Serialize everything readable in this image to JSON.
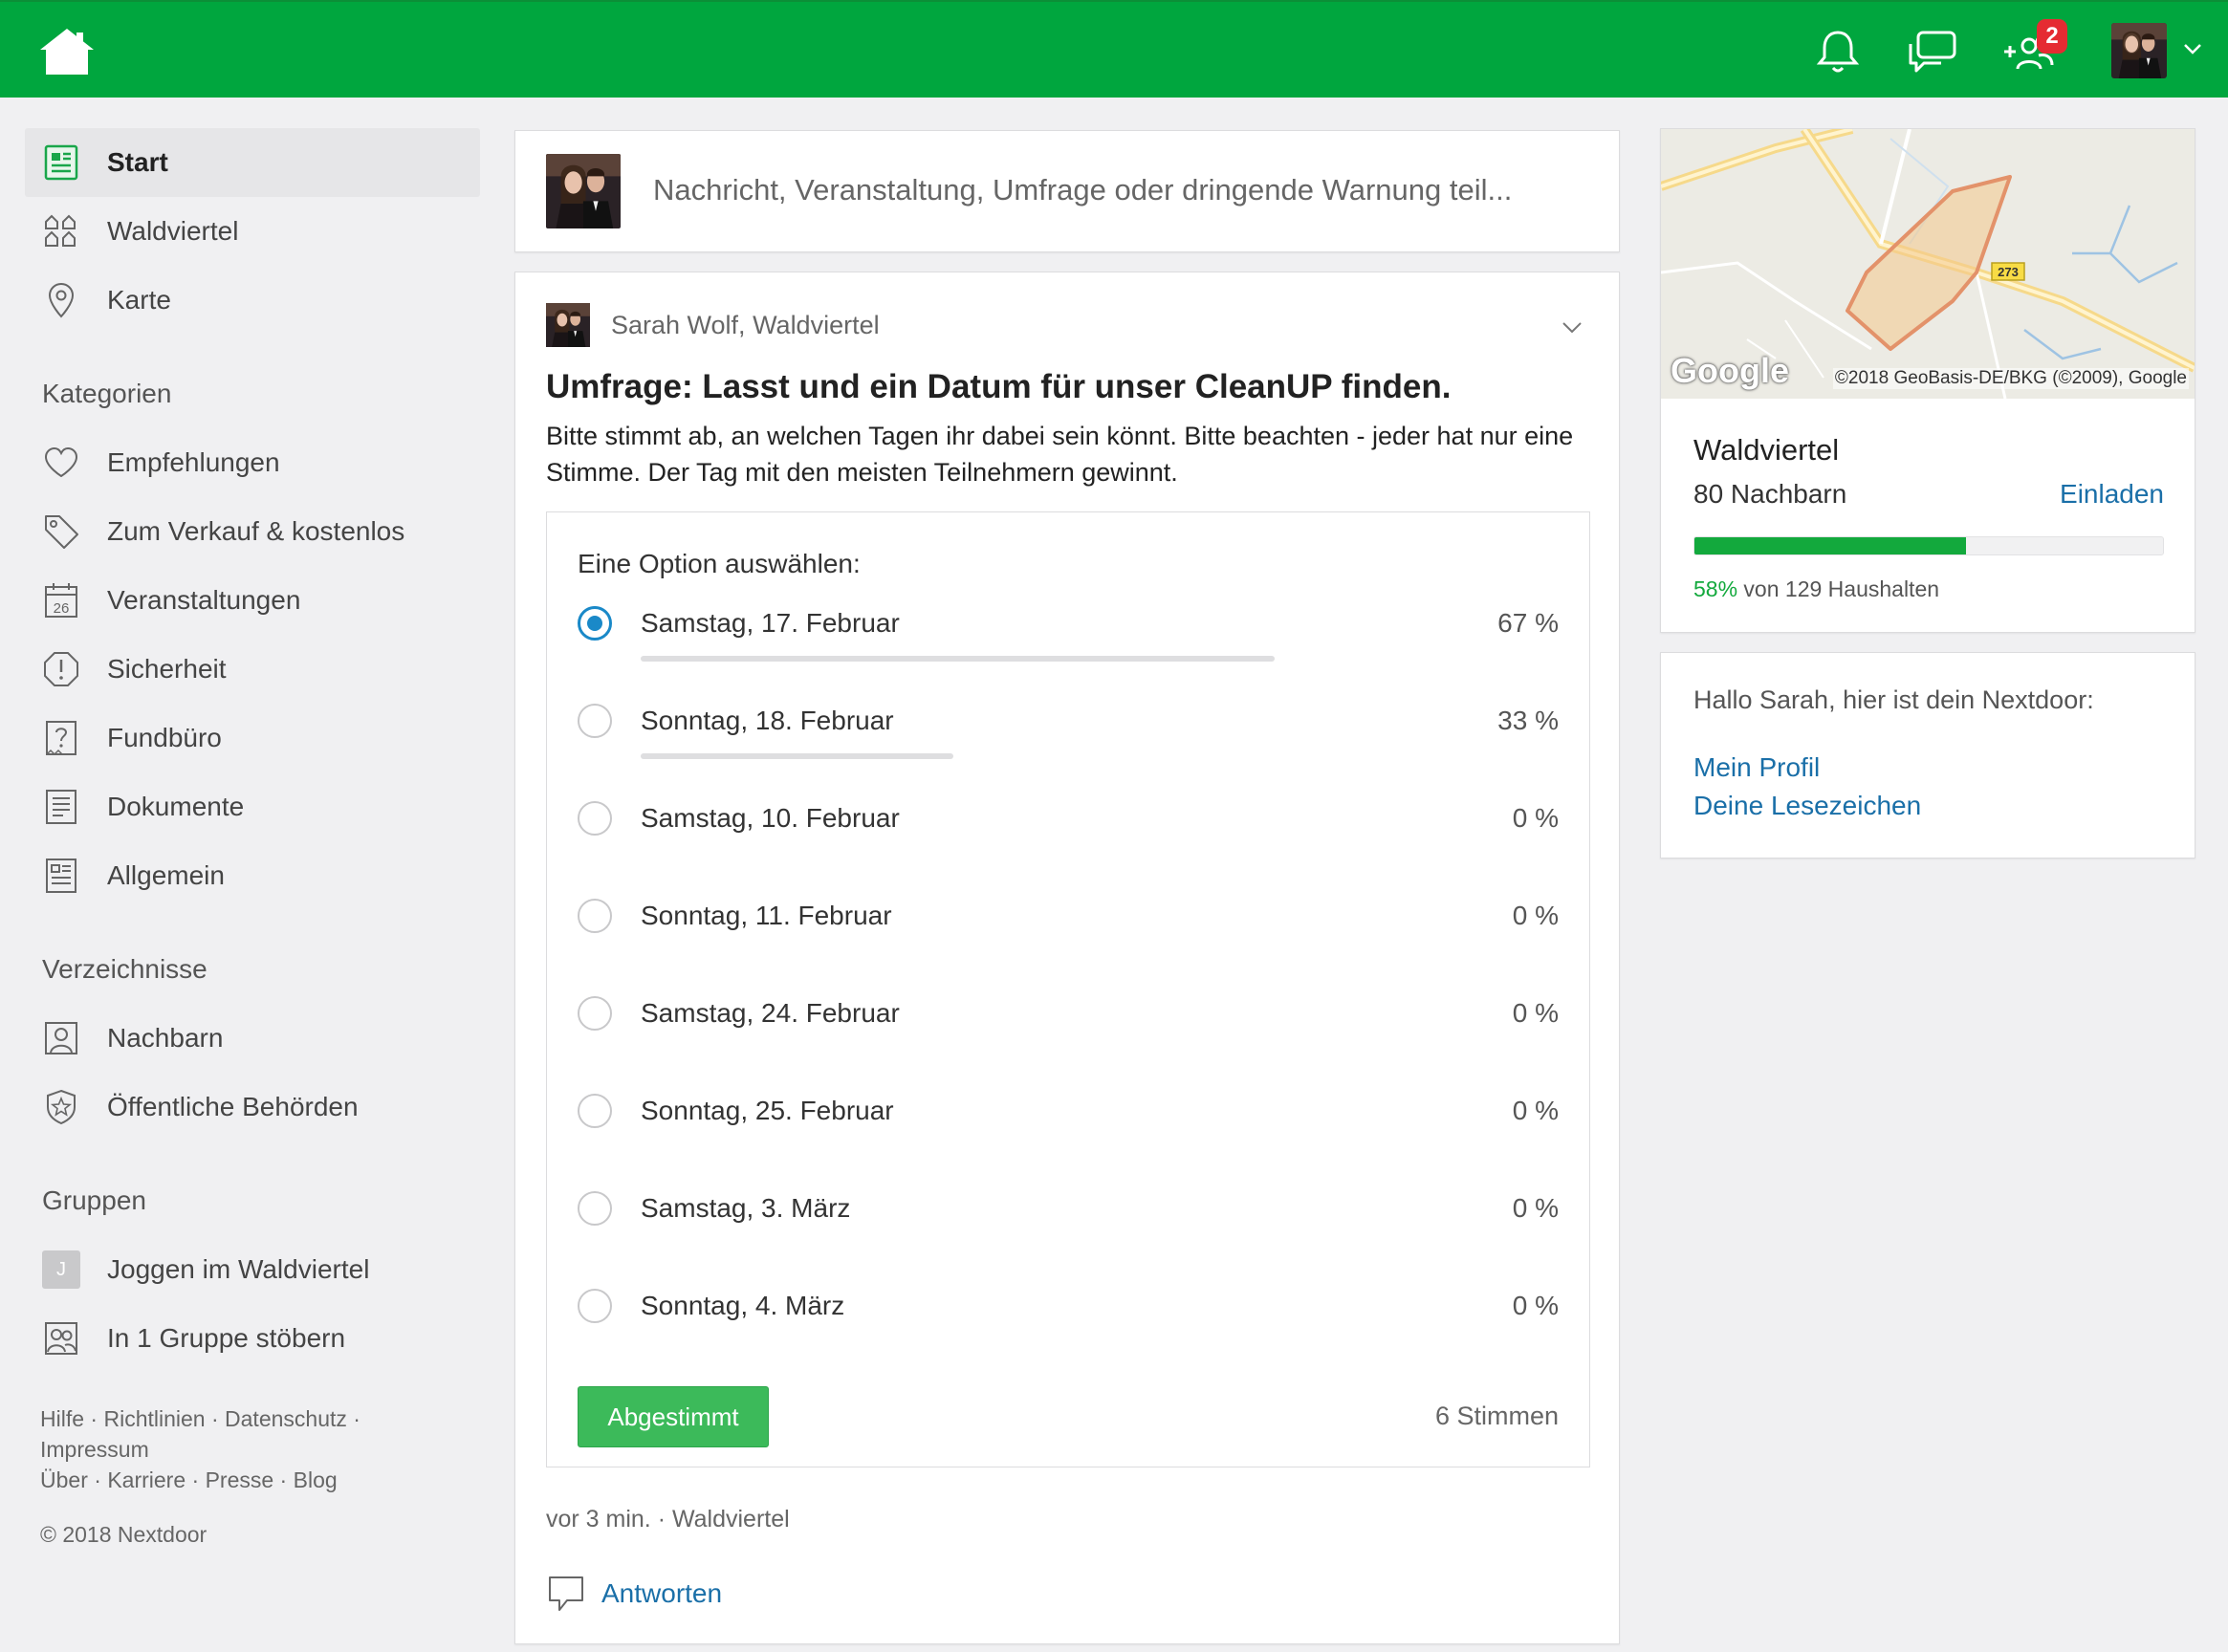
{
  "topbar": {
    "icons": [
      "home-icon",
      "bell-icon",
      "chat-icon",
      "add-neighbors-icon",
      "chevron-down-icon"
    ],
    "notification_count": "2",
    "brand_color": "#00a63e"
  },
  "sidebar": {
    "nav": [
      {
        "label": "Start",
        "icon": "newsfeed-icon"
      },
      {
        "label": "Waldviertel",
        "icon": "neighborhood-icon"
      },
      {
        "label": "Karte",
        "icon": "map-pin-icon"
      }
    ],
    "categories_title": "Kategorien",
    "categories": [
      {
        "label": "Empfehlungen",
        "icon": "heart-icon"
      },
      {
        "label": "Zum Verkauf & kostenlos",
        "icon": "tag-icon"
      },
      {
        "label": "Veranstaltungen",
        "icon": "calendar-icon",
        "calendar_day": "26"
      },
      {
        "label": "Sicherheit",
        "icon": "warning-icon"
      },
      {
        "label": "Fundbüro",
        "icon": "lost-found-icon"
      },
      {
        "label": "Dokumente",
        "icon": "document-icon"
      },
      {
        "label": "Allgemein",
        "icon": "general-icon"
      }
    ],
    "directories_title": "Verzeichnisse",
    "directories": [
      {
        "label": "Nachbarn",
        "icon": "neighbor-icon"
      },
      {
        "label": "Öffentliche Behörden",
        "icon": "badge-icon"
      }
    ],
    "groups_title": "Gruppen",
    "groups": [
      {
        "label": "Joggen im Waldviertel",
        "badge": "J"
      },
      {
        "label": "In 1 Gruppe stöbern",
        "icon": "browse-groups-icon"
      }
    ],
    "footer": {
      "line1": [
        "Hilfe",
        "Richtlinien",
        "Datenschutz"
      ],
      "line2": [
        "Impressum"
      ],
      "line3": [
        "Über",
        "Karriere",
        "Presse",
        "Blog"
      ],
      "copyright": "© 2018 Nextdoor"
    }
  },
  "composer": {
    "placeholder": "Nachricht, Veranstaltung, Umfrage oder dringende Warnung teil..."
  },
  "post": {
    "author": "Sarah Wolf, Waldviertel",
    "title": "Umfrage: Lasst und ein Datum für unser CleanUP finden.",
    "body": "Bitte stimmt ab, an welchen Tagen ihr dabei sein könnt. Bitte beachten - jeder hat nur eine Stimme. Der Tag mit den meisten Teilnehmern gewinnt.",
    "poll": {
      "prompt": "Eine Option auswählen:",
      "options": [
        {
          "label": "Samstag, 17. Februar",
          "pct_label": "67 %",
          "share": 0.67,
          "selected": true
        },
        {
          "label": "Sonntag, 18. Februar",
          "pct_label": "33 %",
          "share": 0.33,
          "selected": false
        },
        {
          "label": "Samstag, 10. Februar",
          "pct_label": "0 %",
          "share": 0,
          "selected": false
        },
        {
          "label": "Sonntag, 11. Februar",
          "pct_label": "0 %",
          "share": 0,
          "selected": false
        },
        {
          "label": "Samstag, 24. Februar",
          "pct_label": "0 %",
          "share": 0,
          "selected": false
        },
        {
          "label": "Sonntag, 25. Februar",
          "pct_label": "0 %",
          "share": 0,
          "selected": false
        },
        {
          "label": "Samstag, 3. März",
          "pct_label": "0 %",
          "share": 0,
          "selected": false
        },
        {
          "label": "Sonntag, 4. März",
          "pct_label": "0 %",
          "share": 0,
          "selected": false
        }
      ],
      "vote_button": "Abgestimmt",
      "votes": "6 Stimmen"
    },
    "meta": "vor 3 min. · Waldviertel",
    "reply_label": "Antworten"
  },
  "neighborhood": {
    "map_logo": "Google",
    "map_copyright": "©2018 GeoBasis-DE/BKG (©2009), Google",
    "map_road_label": "273",
    "name": "Waldviertel",
    "neighbors": "80 Nachbarn",
    "invite": "Einladen",
    "progress": 0.58,
    "progress_pct": "58%",
    "progress_text": " von 129 Haushalten"
  },
  "hello": {
    "text": "Hallo Sarah, hier ist dein Nextdoor:",
    "links": [
      "Mein Profil",
      "Deine Lesezeichen"
    ]
  }
}
